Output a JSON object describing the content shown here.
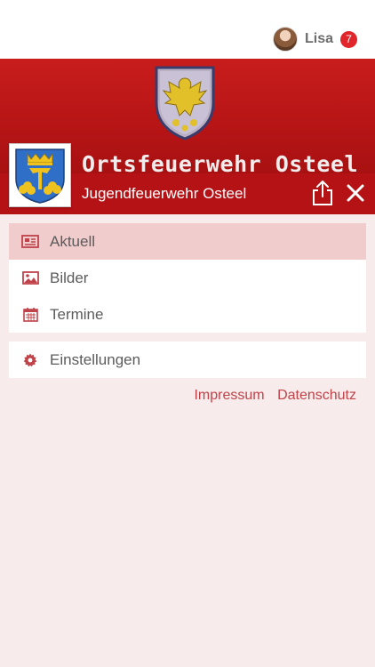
{
  "header": {
    "user_name": "Lisa",
    "notification_count": "7"
  },
  "banner": {
    "text": "Ortsfeuerwehr Osteel"
  },
  "titlebar": {
    "title": "Jugendfeuerwehr Osteel",
    "share_icon": "share-icon",
    "close_icon": "close-icon"
  },
  "menu": {
    "items": [
      {
        "label": "Aktuell",
        "icon": "newspaper-icon",
        "active": true
      },
      {
        "label": "Bilder",
        "icon": "image-icon",
        "active": false
      },
      {
        "label": "Termine",
        "icon": "calendar-icon",
        "active": false
      }
    ],
    "settings": {
      "label": "Einstellungen",
      "icon": "gear-icon"
    }
  },
  "footer_links": {
    "impressum": "Impressum",
    "datenschutz": "Datenschutz"
  },
  "colors": {
    "brand_red": "#b51216",
    "active_bg": "#f0cccc",
    "page_bg": "#f8ebeb",
    "link": "#c0434a",
    "badge": "#e0252b"
  }
}
